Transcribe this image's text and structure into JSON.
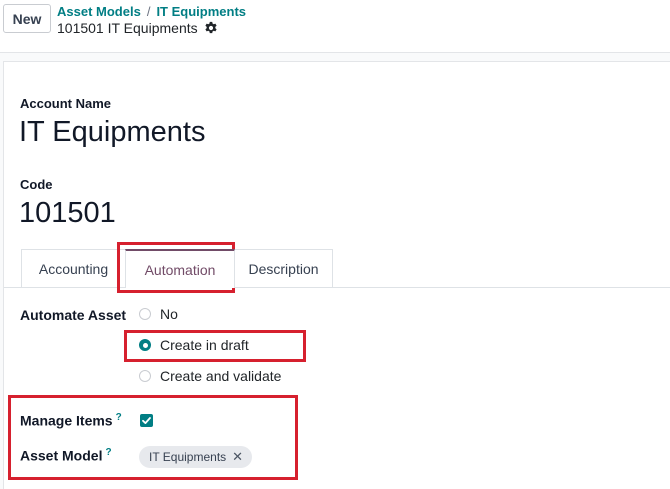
{
  "control_panel": {
    "new_button": "New",
    "breadcrumb": [
      "Asset Models",
      "IT Equipments"
    ],
    "breadcrumb_separator": "/",
    "record_title": "101501 IT Equipments"
  },
  "form": {
    "account_name_label": "Account Name",
    "account_name_value": "IT Equipments",
    "code_label": "Code",
    "code_value": "101501"
  },
  "tabs": [
    {
      "label": "Accounting",
      "active": false
    },
    {
      "label": "Automation",
      "active": true
    },
    {
      "label": "Description",
      "active": false
    }
  ],
  "automation": {
    "automate_asset_label": "Automate Asset",
    "options": [
      {
        "label": "No",
        "checked": false
      },
      {
        "label": "Create in draft",
        "checked": true
      },
      {
        "label": "Create and validate",
        "checked": false
      }
    ],
    "manage_items_label": "Manage Items",
    "manage_items_checked": true,
    "asset_model_label": "Asset Model",
    "asset_model_tag": "IT Equipments",
    "help_mark": "?",
    "tag_remove": "✕"
  },
  "colors": {
    "accent": "#017e84",
    "tab_active": "#714b67",
    "highlight": "#d6202e"
  }
}
